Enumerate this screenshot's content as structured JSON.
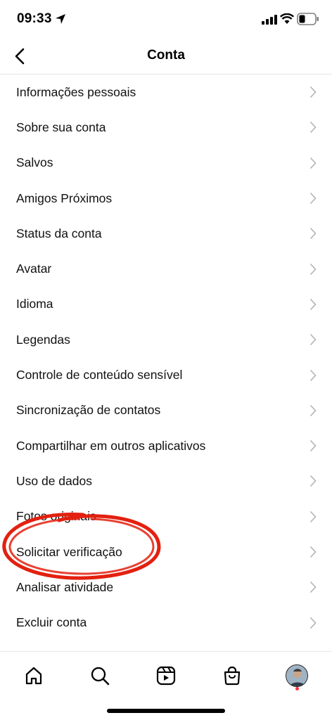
{
  "status_bar": {
    "time": "09:33"
  },
  "header": {
    "title": "Conta"
  },
  "settings": {
    "items": [
      {
        "label": "Informações pessoais"
      },
      {
        "label": "Sobre sua conta"
      },
      {
        "label": "Salvos"
      },
      {
        "label": "Amigos Próximos"
      },
      {
        "label": "Status da conta"
      },
      {
        "label": "Avatar"
      },
      {
        "label": "Idioma"
      },
      {
        "label": "Legendas"
      },
      {
        "label": "Controle de conteúdo sensível"
      },
      {
        "label": "Sincronização de contatos"
      },
      {
        "label": "Compartilhar em outros aplicativos"
      },
      {
        "label": "Uso de dados"
      },
      {
        "label": "Fotos originais"
      },
      {
        "label": "Solicitar verificação"
      },
      {
        "label": "Analisar atividade"
      },
      {
        "label": "Excluir conta"
      }
    ]
  },
  "tab_bar": {
    "tabs": [
      {
        "icon": "home-icon"
      },
      {
        "icon": "search-icon"
      },
      {
        "icon": "reels-icon"
      },
      {
        "icon": "shop-icon"
      },
      {
        "icon": "profile-avatar"
      }
    ]
  },
  "colors": {
    "annotation": "#e3200f",
    "notification": "#ff3040"
  }
}
